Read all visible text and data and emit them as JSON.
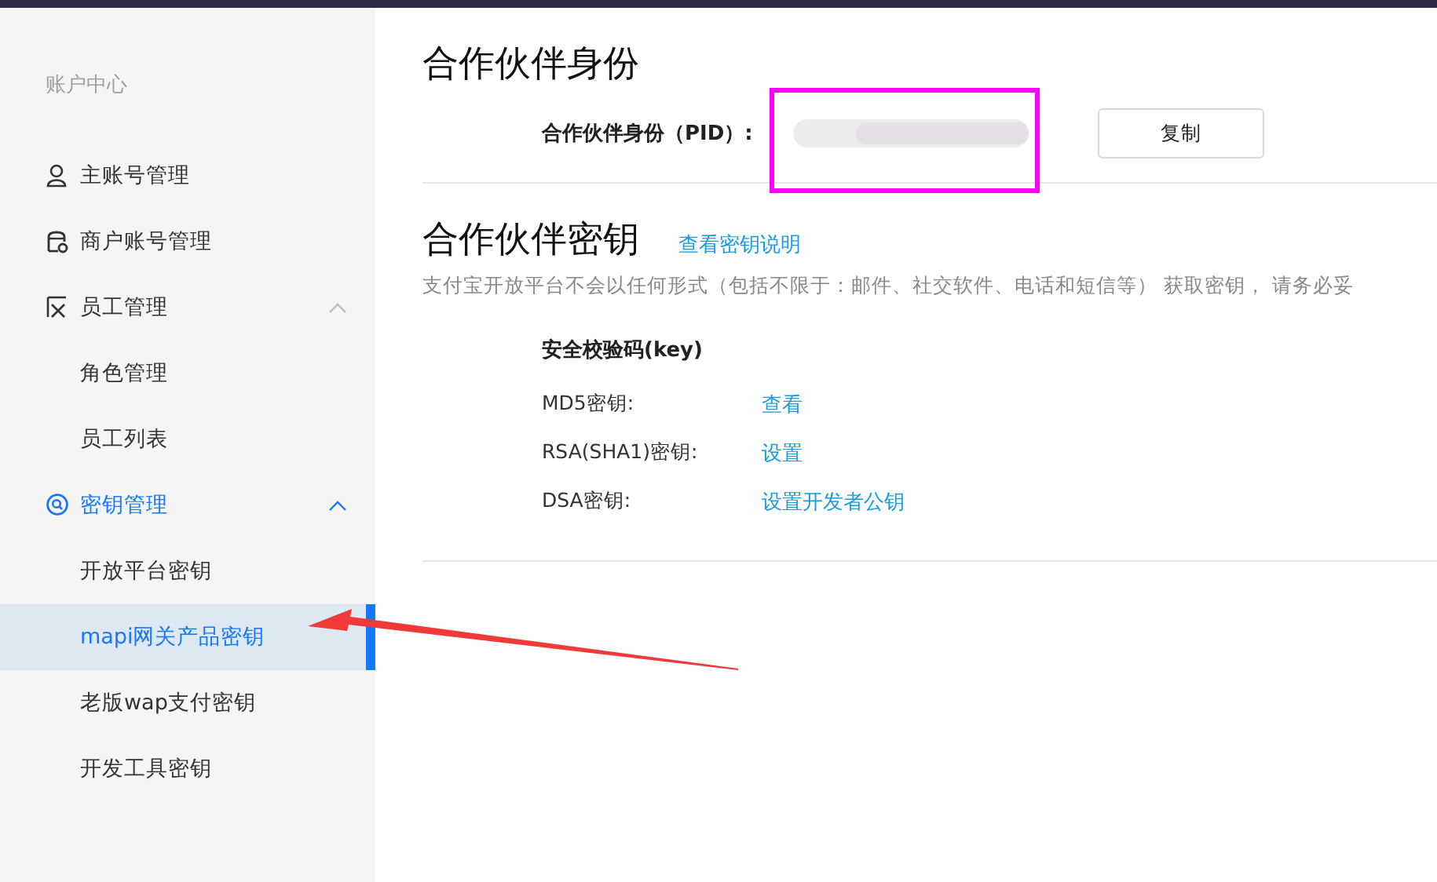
{
  "sidebar": {
    "heading": "账户中心",
    "items": [
      {
        "label": "主账号管理",
        "selected": false
      },
      {
        "label": "商户账号管理",
        "selected": false
      },
      {
        "label": "员工管理",
        "selected": false,
        "expanded": true,
        "children": [
          {
            "label": "角色管理",
            "selected": false
          },
          {
            "label": "员工列表",
            "selected": false
          }
        ]
      },
      {
        "label": "密钥管理",
        "selected": false,
        "expanded": true,
        "children": [
          {
            "label": "开放平台密钥",
            "selected": false
          },
          {
            "label": "mapi网关产品密钥",
            "selected": true
          },
          {
            "label": "老版wap支付密钥",
            "selected": false
          },
          {
            "label": "开发工具密钥",
            "selected": false
          }
        ]
      }
    ]
  },
  "identity": {
    "title": "合作伙伴身份",
    "pid_label": "合作伙伴身份（PID）:",
    "pid_value": {
      "kind": "redacted"
    },
    "copy_button": "复制"
  },
  "keys": {
    "title": "合作伙伴密钥",
    "help_link": "查看密钥说明",
    "notice": "支付宝开放平台不会以任何形式（包括不限于：邮件、社交软件、电话和短信等） 获取密钥， 请务必妥",
    "group_title": "安全校验码(key)",
    "rows": [
      {
        "label": "MD5密钥:",
        "action": "查看"
      },
      {
        "label": "RSA(SHA1)密钥:",
        "action": "设置"
      },
      {
        "label": "DSA密钥:",
        "action": "设置开发者公钥"
      }
    ]
  },
  "annotations": [
    {
      "kind": "box",
      "color": "#ff00ff"
    },
    {
      "kind": "arrow",
      "color": "#f03a3a"
    }
  ]
}
